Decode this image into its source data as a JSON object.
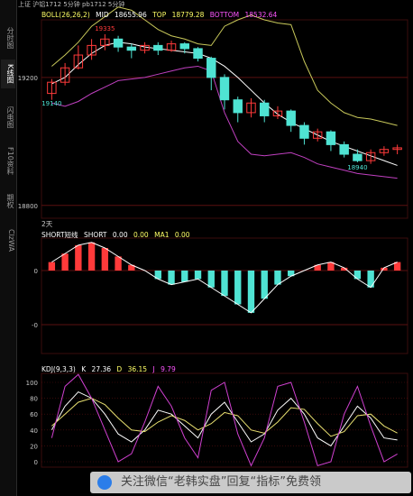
{
  "title_strip": "上证 沪铝1712 5分钟 pb1712 5分钟",
  "sidebar": {
    "tabs": [
      {
        "label": "分时图",
        "active": false
      },
      {
        "label": "K线图",
        "active": true
      },
      {
        "label": "闪电图",
        "active": false
      },
      {
        "label": "F10资料",
        "active": false
      },
      {
        "label": "期权",
        "active": false
      },
      {
        "label": "ClzWA",
        "active": false
      }
    ]
  },
  "main_panel": {
    "indicator": "BOLL(26,26,2)",
    "mid_label": "MID",
    "mid_value": "18655.96",
    "top_label": "TOP",
    "top_value": "18779.28",
    "bottom_label": "BOTTOM",
    "bottom_value": "18532.64",
    "ylabels": [
      "19200",
      "18800"
    ],
    "annotations": [
      "19335",
      "19140",
      "18940"
    ],
    "period_label": "2天"
  },
  "short_panel": {
    "indicator": "SHORT短线",
    "short_label": "SHORT",
    "short_value": "0.00",
    "value2": "0.00",
    "ma1_label": "MA1",
    "ma1_value": "0.00",
    "ylabels": [
      "0",
      "-0"
    ]
  },
  "kdj_panel": {
    "indicator": "KDJ(9,3,3)",
    "k_label": "K",
    "k_value": "27.36",
    "d_label": "D",
    "d_value": "36.15",
    "j_label": "J",
    "j_value": "9.79",
    "ylabels": [
      "100",
      "80",
      "60",
      "40",
      "20",
      "0"
    ]
  },
  "watermark": "关注微信“老韩实盘”回复“指标”免费领",
  "colors": {
    "up": "#ff3a3a",
    "down": "#4fe3d3",
    "mid": "#ffffff",
    "top": "#c8c85a",
    "bottom": "#c040c0",
    "k": "#ffffff",
    "d": "#e8e070",
    "j": "#d040d0",
    "grid": "#5a1010",
    "boll_header": "#ffff66",
    "top_header": "#ffffff",
    "bottom_header": "#ff55ff"
  },
  "chart_data": [
    {
      "type": "candlestick",
      "title": "BOLL(26,26,2)",
      "ylabels": [
        "19200",
        "18800"
      ],
      "series": [
        {
          "name": "MID",
          "values": [
            19180,
            19200,
            19240,
            19275,
            19300,
            19310,
            19305,
            19295,
            19290,
            19285,
            19280,
            19275,
            19260,
            19235,
            19200,
            19160,
            19120,
            19085,
            19060,
            19040,
            19020,
            19000,
            18985,
            18970,
            18955,
            18940,
            18925
          ]
        },
        {
          "name": "TOP",
          "values": [
            19235,
            19270,
            19310,
            19360,
            19390,
            19420,
            19410,
            19380,
            19350,
            19330,
            19320,
            19305,
            19300,
            19360,
            19380,
            19395,
            19380,
            19370,
            19365,
            19250,
            19160,
            19120,
            19090,
            19075,
            19070,
            19060,
            19050
          ]
        },
        {
          "name": "BOTTOM",
          "values": [
            19120,
            19110,
            19125,
            19150,
            19170,
            19190,
            19195,
            19200,
            19210,
            19220,
            19230,
            19235,
            19220,
            19090,
            19000,
            18960,
            18955,
            18960,
            18965,
            18950,
            18930,
            18920,
            18910,
            18900,
            18895,
            18890,
            18885
          ]
        }
      ],
      "candles": [
        [
          19150,
          19185,
          19130,
          19195
        ],
        [
          19185,
          19230,
          19175,
          19245
        ],
        [
          19230,
          19270,
          19225,
          19300
        ],
        [
          19270,
          19300,
          19255,
          19320
        ],
        [
          19300,
          19320,
          19285,
          19335
        ],
        [
          19320,
          19295,
          19280,
          19330
        ],
        [
          19295,
          19285,
          19260,
          19305
        ],
        [
          19285,
          19300,
          19275,
          19310
        ],
        [
          19300,
          19285,
          19270,
          19310
        ],
        [
          19285,
          19305,
          19280,
          19315
        ],
        [
          19305,
          19290,
          19275,
          19310
        ],
        [
          19290,
          19260,
          19250,
          19295
        ],
        [
          19260,
          19200,
          19160,
          19265
        ],
        [
          19200,
          19130,
          19100,
          19210
        ],
        [
          19130,
          19090,
          19060,
          19140
        ],
        [
          19090,
          19120,
          19075,
          19135
        ],
        [
          19120,
          19080,
          19060,
          19130
        ],
        [
          19080,
          19095,
          19070,
          19110
        ],
        [
          19095,
          19050,
          19030,
          19100
        ],
        [
          19050,
          19010,
          18990,
          19060
        ],
        [
          19010,
          19030,
          19000,
          19040
        ],
        [
          19030,
          18990,
          18970,
          19035
        ],
        [
          18990,
          18960,
          18950,
          19000
        ],
        [
          18960,
          18940,
          18935,
          18975
        ],
        [
          18940,
          18965,
          18930,
          18975
        ],
        [
          18965,
          18975,
          18955,
          18985
        ],
        [
          18975,
          18980,
          18960,
          18990
        ]
      ],
      "annotations": [
        {
          "text": "19335",
          "value": 19335
        },
        {
          "text": "19140",
          "value": 19140
        },
        {
          "text": "18940",
          "value": 18940
        }
      ]
    },
    {
      "type": "bar",
      "title": "SHORT短线",
      "ylabels": [
        "0",
        "-0"
      ],
      "values": [
        0.3,
        0.6,
        0.9,
        1.0,
        0.8,
        0.5,
        0.2,
        0.0,
        -0.3,
        -0.5,
        -0.4,
        -0.3,
        -0.6,
        -0.9,
        -1.2,
        -1.5,
        -1.0,
        -0.5,
        -0.2,
        0.0,
        0.2,
        0.3,
        0.1,
        -0.3,
        -0.6,
        0.1,
        0.3
      ]
    },
    {
      "type": "line",
      "title": "KDJ(9,3,3)",
      "ylabels": [
        "100",
        "80",
        "60",
        "40",
        "20",
        "0"
      ],
      "series": [
        {
          "name": "K",
          "values": [
            40,
            70,
            88,
            80,
            60,
            35,
            25,
            40,
            65,
            60,
            45,
            30,
            60,
            75,
            50,
            25,
            35,
            65,
            80,
            60,
            30,
            20,
            45,
            70,
            55,
            30,
            27.36
          ]
        },
        {
          "name": "D",
          "values": [
            45,
            60,
            75,
            80,
            72,
            55,
            40,
            38,
            50,
            58,
            52,
            40,
            48,
            62,
            58,
            40,
            36,
            50,
            68,
            66,
            48,
            32,
            38,
            58,
            60,
            45,
            36.15
          ]
        },
        {
          "name": "J",
          "values": [
            30,
            95,
            110,
            80,
            40,
            0,
            10,
            50,
            95,
            70,
            30,
            5,
            90,
            100,
            35,
            -5,
            30,
            95,
            100,
            50,
            -5,
            0,
            60,
            95,
            45,
            0,
            9.79
          ]
        }
      ]
    }
  ]
}
